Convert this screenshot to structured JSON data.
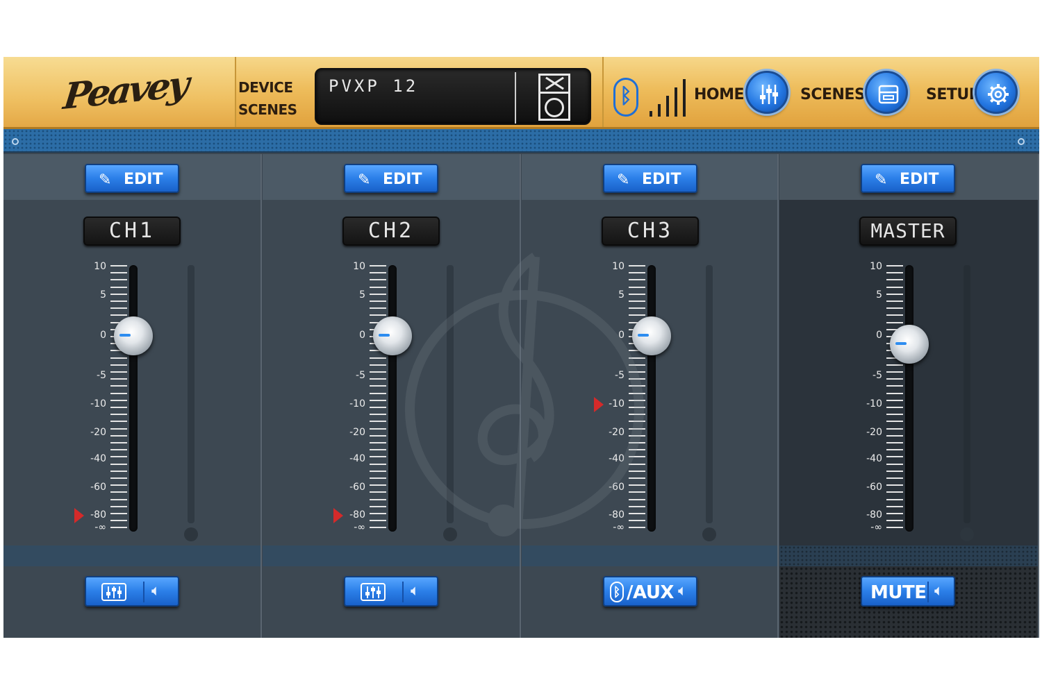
{
  "logo": {
    "text": "Peavey"
  },
  "header": {
    "device_label": "DEVICE",
    "scenes_label": "SCENES",
    "device_display": "PVXP 12",
    "nav": [
      {
        "label": "HOME",
        "icon": "mixer-sliders-icon"
      },
      {
        "label": "SCENES",
        "icon": "scenes-icon"
      },
      {
        "label": "SETUP",
        "icon": "gear-icon"
      }
    ],
    "bluetooth_icon": "bluetooth-icon",
    "signal_icon": "signal-strength-icon"
  },
  "scale_labels": [
    "10",
    "5",
    "0",
    "-5",
    "-10",
    "-20",
    "-40",
    "-60",
    "-80",
    "-∞"
  ],
  "channels": [
    {
      "edit_label": "EDIT",
      "name": "CH1",
      "fader_db": "0",
      "marker_db": "-80",
      "mode_label": "",
      "mode_icon": "mixer-icon"
    },
    {
      "edit_label": "EDIT",
      "name": "CH2",
      "fader_db": "0",
      "marker_db": "-80",
      "mode_label": "",
      "mode_icon": "mixer-icon"
    },
    {
      "edit_label": "EDIT",
      "name": "CH3",
      "fader_db": "0",
      "marker_db": "-10",
      "mode_label": "/AUX",
      "mode_icon": "bluetooth-icon"
    },
    {
      "edit_label": "EDIT",
      "name": "MASTER",
      "fader_db": "-1",
      "marker_db": "",
      "mode_label": "MUTE",
      "mode_icon": ""
    }
  ],
  "colors": {
    "accent_blue": "#2b7fe8",
    "header_gold": "#eebd5c",
    "marker_red": "#d42a2a"
  }
}
